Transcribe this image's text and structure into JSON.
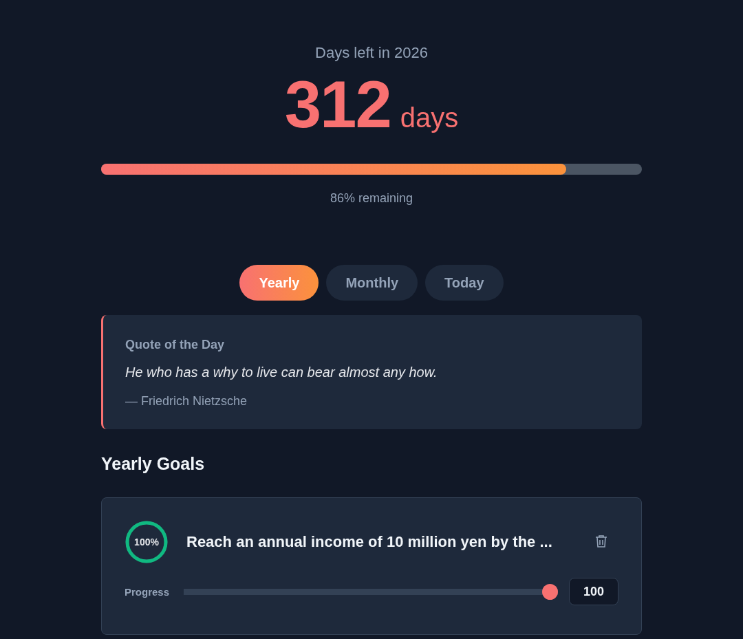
{
  "header": {
    "title": "Days left in 2026",
    "count": "312",
    "unit": "days",
    "level": 0.86,
    "reading": "86% remaining"
  },
  "tabs": [
    {
      "label": "Yearly",
      "selected": true
    },
    {
      "label": "Monthly",
      "selected": false
    },
    {
      "label": "Today",
      "selected": false
    }
  ],
  "quote": {
    "heading": "Quote of the Day",
    "text": "He who has a why to live can bear almost any how.",
    "author": "— Friedrich Nietzsche"
  },
  "goals_heading": "Yearly Goals",
  "goals": [
    {
      "percent": "100%",
      "level": 1,
      "title": "Reach an annual income of 10 million yen by the ...",
      "progress_label": "Progress",
      "value": "100"
    }
  ]
}
